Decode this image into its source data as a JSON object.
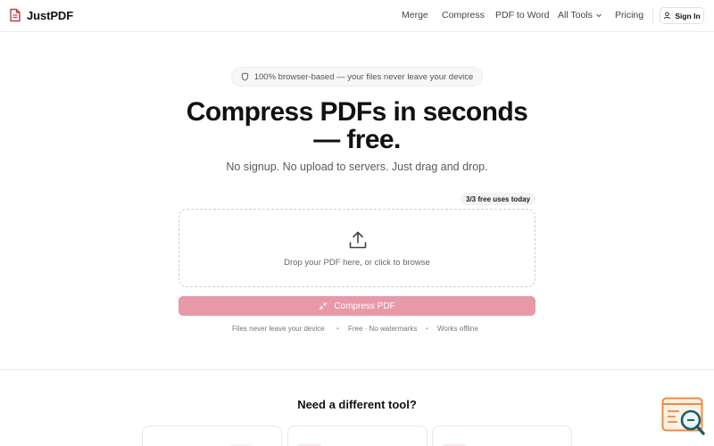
{
  "brand": {
    "name": "JustPDF",
    "accent": "#c0394a"
  },
  "nav": {
    "items": [
      {
        "label": "Merge"
      },
      {
        "label": "Compress"
      },
      {
        "label": "PDF to Word"
      },
      {
        "label": "All Tools"
      },
      {
        "label": "Pricing"
      }
    ],
    "signin_label": "Sign In"
  },
  "hero": {
    "pill_text": "100% browser-based — your files never leave your device",
    "headline_line1": "Compress PDFs in seconds",
    "headline_line2": "— free.",
    "subline": "No signup. No upload to servers. Just drag and drop."
  },
  "uploader": {
    "uses_badge": "3/3 free uses today",
    "drop_text": "Drop your PDF here, or click to browse",
    "button_label": "Compress PDF",
    "button_color": "#e899a8"
  },
  "trust": {
    "items": [
      "Files never leave your device",
      "Free · No watermarks",
      "Works offline"
    ]
  },
  "tools_section": {
    "title": "Need a different tool?"
  },
  "icons": {
    "logo": "pdf-file-icon",
    "shield": "shield-icon",
    "user": "user-icon",
    "chevron": "chevron-down-icon",
    "upload": "upload-icon",
    "compress": "compress-arrows-icon",
    "chat": "chat-search-icon"
  }
}
